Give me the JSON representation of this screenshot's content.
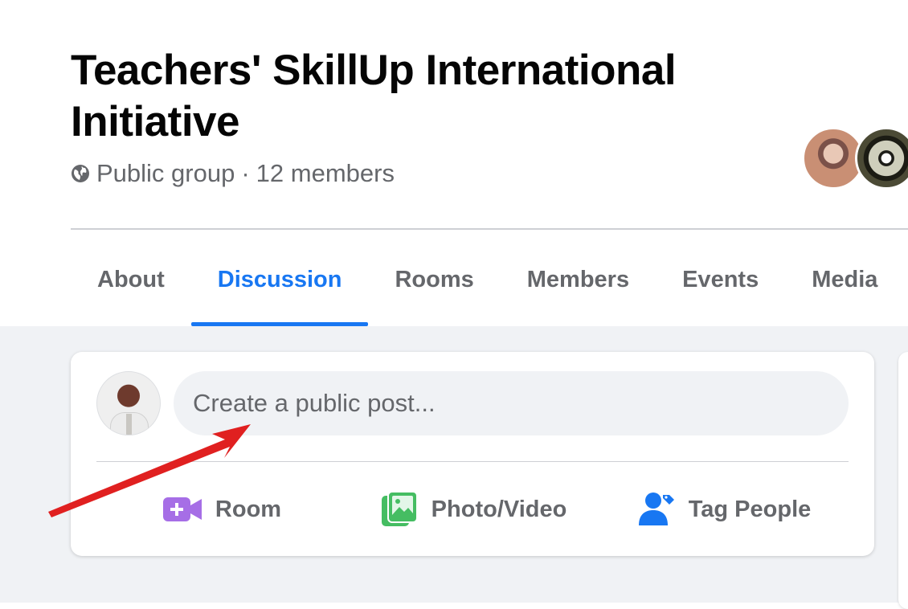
{
  "group": {
    "title": "Teachers' SkillUp International Initiative",
    "privacy": "Public group",
    "separator": "·",
    "member_count": "12 members"
  },
  "tabs": [
    {
      "label": "About",
      "active": false
    },
    {
      "label": "Discussion",
      "active": true
    },
    {
      "label": "Rooms",
      "active": false
    },
    {
      "label": "Members",
      "active": false
    },
    {
      "label": "Events",
      "active": false
    },
    {
      "label": "Media",
      "active": false
    }
  ],
  "composer": {
    "placeholder": "Create a public post...",
    "actions": [
      {
        "label": "Room",
        "icon": "video-plus-icon"
      },
      {
        "label": "Photo/Video",
        "icon": "photo-icon"
      },
      {
        "label": "Tag People",
        "icon": "tag-people-icon"
      }
    ]
  },
  "colors": {
    "accent": "#1877f2",
    "room": "#a66ee6",
    "photo": "#45bd62",
    "tag": "#1877f2",
    "annotation_arrow": "#e02020"
  }
}
